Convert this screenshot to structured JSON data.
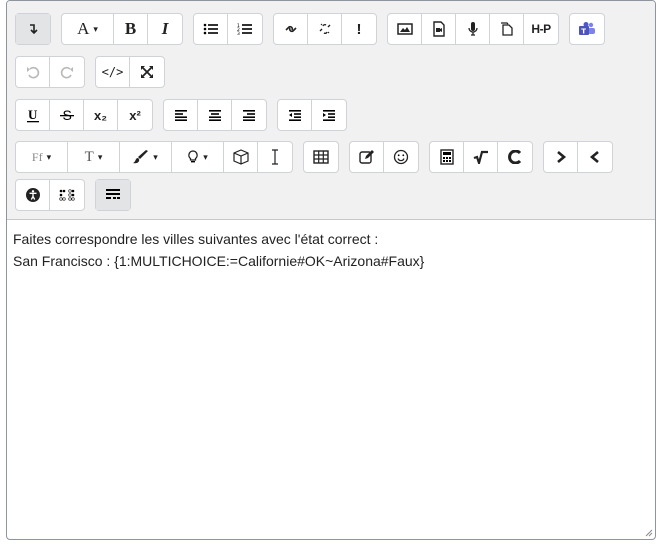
{
  "toolbar": {
    "bold_label": "B",
    "italic_label": "I",
    "undo_label": "↶",
    "redo_label": "↷",
    "html_label": "</>",
    "subscript_label": "x₂",
    "superscript_label": "x²",
    "h5p_label": "H-P",
    "exclamation_label": "!",
    "font_label": "Ff",
    "fontsize_label": "T",
    "caret": "▾"
  },
  "content": {
    "line1": "Faites correspondre les villes suivantes avec l'état correct :",
    "line2": "San Francisco :  {1:MULTICHOICE:=Californie#OK~Arizona#Faux}"
  },
  "colors": {
    "teams_purple": "#5059c9",
    "toolbar_bg": "#f1f1f1"
  }
}
